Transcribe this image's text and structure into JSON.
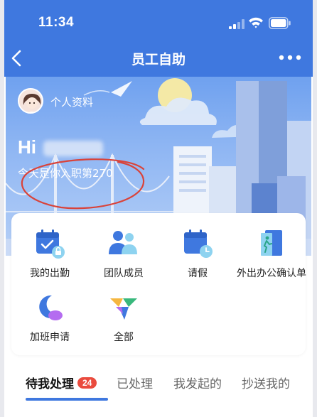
{
  "status_bar": {
    "time": "11:34",
    "icons": [
      "signal-icon",
      "wifi-icon",
      "battery-icon"
    ]
  },
  "nav": {
    "title": "员工自助",
    "back_icon": "back-chevron-icon",
    "more_icon": "more-dots-icon"
  },
  "banner": {
    "profile_label": "个人资料",
    "greeting": "Hi",
    "entry_text": "今天是你入职第270"
  },
  "quick_actions": [
    {
      "label": "我的出勤",
      "icon": "attendance-icon"
    },
    {
      "label": "团队成员",
      "icon": "team-icon"
    },
    {
      "label": "请假",
      "icon": "leave-icon"
    },
    {
      "label": "外出办公确认单",
      "icon": "outing-icon"
    },
    {
      "label": "加班申请",
      "icon": "overtime-icon"
    },
    {
      "label": "全部",
      "icon": "all-apps-icon"
    }
  ],
  "tabs": [
    {
      "label": "待我处理",
      "badge": "24",
      "active": true
    },
    {
      "label": "已处理",
      "active": false
    },
    {
      "label": "我发起的",
      "active": false
    },
    {
      "label": "抄送我的",
      "active": false
    }
  ],
  "colors": {
    "primary": "#3f78df",
    "badge": "#ea4b3e",
    "annotation": "#d9433a"
  }
}
